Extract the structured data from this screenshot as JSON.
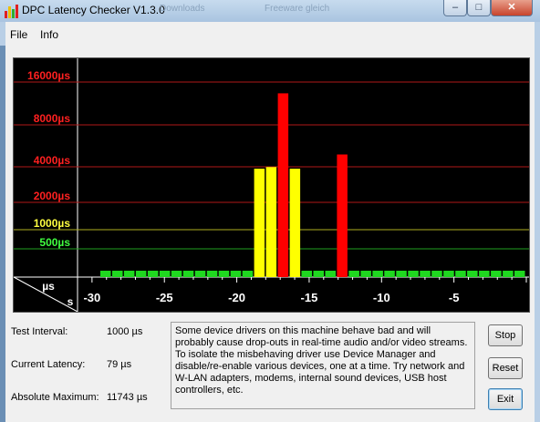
{
  "window": {
    "title": "DPC Latency Checker V1.3.0",
    "bg_tabs": [
      "Downloads",
      "Freeware gleich"
    ]
  },
  "menu": {
    "items": [
      "File",
      "Info"
    ]
  },
  "controls": {
    "minimize": "–",
    "maximize": "□",
    "close": "✕"
  },
  "chart_data": {
    "type": "bar",
    "y_tick_labels": [
      {
        "label": "16000µs",
        "color": "#ff2020",
        "line": "#b01818"
      },
      {
        "label": "8000µs",
        "color": "#ff2020",
        "line": "#b01818"
      },
      {
        "label": "4000µs",
        "color": "#ff2020",
        "line": "#b01818"
      },
      {
        "label": "2000µs",
        "color": "#ff2020",
        "line": "#b01818"
      },
      {
        "label": "1000µs",
        "color": "#ffff40",
        "line": "#b0b020"
      },
      {
        "label": "500µs",
        "color": "#40ff40",
        "line": "#20a020"
      }
    ],
    "y_unit": "µs",
    "x_unit": "s",
    "x_tick_labels": [
      "-30",
      "-25",
      "-20",
      "-15",
      "-10",
      "-5"
    ],
    "xlim": [
      -31,
      0
    ],
    "values_us": [
      79,
      79,
      79,
      79,
      79,
      79,
      79,
      79,
      79,
      79,
      79,
      79,
      79,
      1480,
      1550,
      11743,
      1480,
      79,
      79,
      79,
      2190,
      79,
      79,
      79,
      79,
      79,
      79,
      79,
      79,
      79,
      79,
      79,
      79,
      79,
      79,
      79
    ],
    "x_seconds": [
      -31,
      -30,
      -29,
      -28,
      -27,
      -26,
      -25,
      -24,
      -23,
      -22,
      -21,
      -20,
      -19,
      -19,
      -18,
      -17,
      -16,
      -15,
      -14,
      -13,
      -12,
      -12,
      -11,
      -10,
      -9,
      -8,
      -7,
      -6,
      -5,
      -4,
      -3,
      -2,
      -1,
      -1,
      0,
      0
    ],
    "colors": {
      "green": "#1fd81f",
      "yellow": "#ffff00",
      "red": "#ff0000"
    }
  },
  "fields": [
    {
      "label": "Test Interval:",
      "value": "1000 µs"
    },
    {
      "label": "Current Latency:",
      "value": "79 µs"
    },
    {
      "label": "Absolute Maximum:",
      "value": "11743 µs"
    }
  ],
  "info_text": "Some device drivers on this machine behave bad and will probably cause drop-outs in real-time audio and/or video streams. To isolate the misbehaving driver use Device Manager and disable/re-enable various devices, one at a time. Try network and W-LAN adapters, modems, internal sound devices, USB host controllers, etc.",
  "buttons": {
    "stop": "Stop",
    "reset": "Reset",
    "exit": "Exit"
  }
}
